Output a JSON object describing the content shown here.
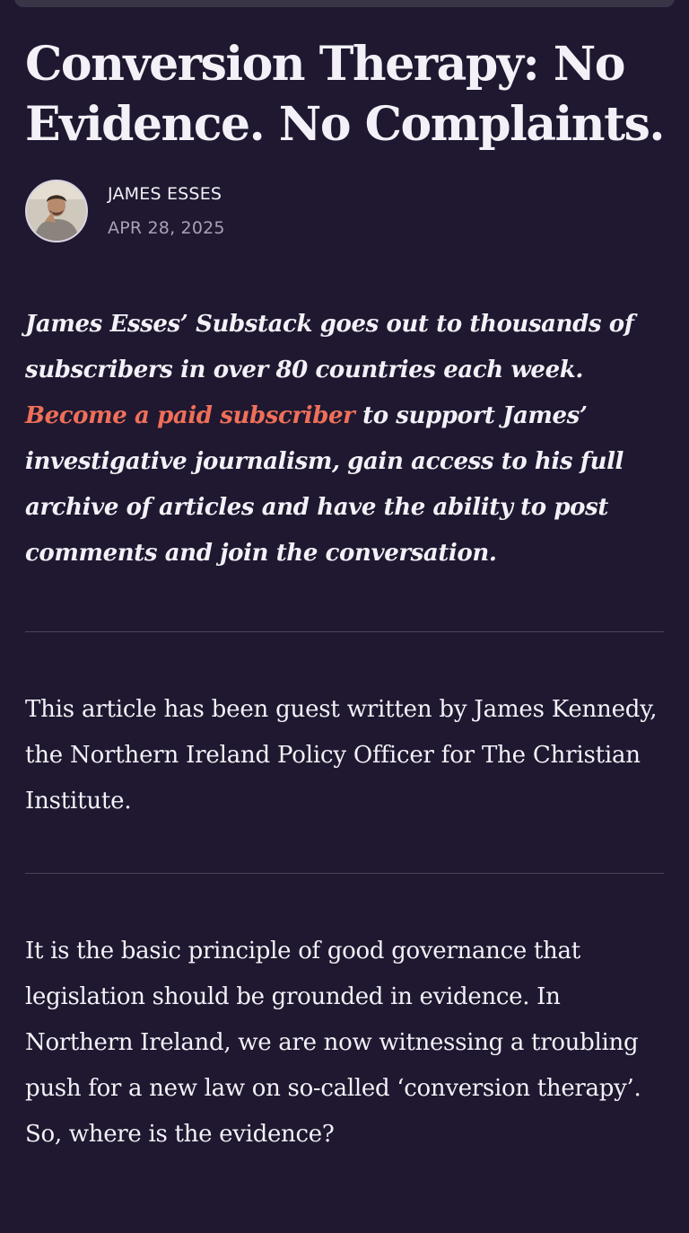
{
  "article": {
    "title": "Conversion Therapy: No Evidence. No Complaints.",
    "author": "JAMES ESSES",
    "date": "APR 28, 2025",
    "promo": {
      "line_start": "James Esses’ Substack goes out to thousands of subscribers in over 80 countries each week.",
      "link_text": "Become a paid subscriber",
      "line_end": "to support James’ investigative journalism, gain access to his full archive of articles and have the ability to post comments and join the conversation."
    },
    "guest_note": "This article has been guest written by James Kennedy, the Northern Ireland Policy Officer for The Christian Institute.",
    "body_paragraph": "It is the basic principle of good governance that legislation should be grounded in evidence. In Northern Ireland, we are now witnessing a troubling push for a new law on so-called ‘conversion therapy’. So, where is the evidence?"
  },
  "colors": {
    "background": "#1f1830",
    "text": "#f3f1f7",
    "accent_link": "#ef6f58",
    "muted": "#a8a1b5",
    "divider": "#4a4357"
  },
  "icons": {
    "avatar": "author-avatar-photo"
  }
}
